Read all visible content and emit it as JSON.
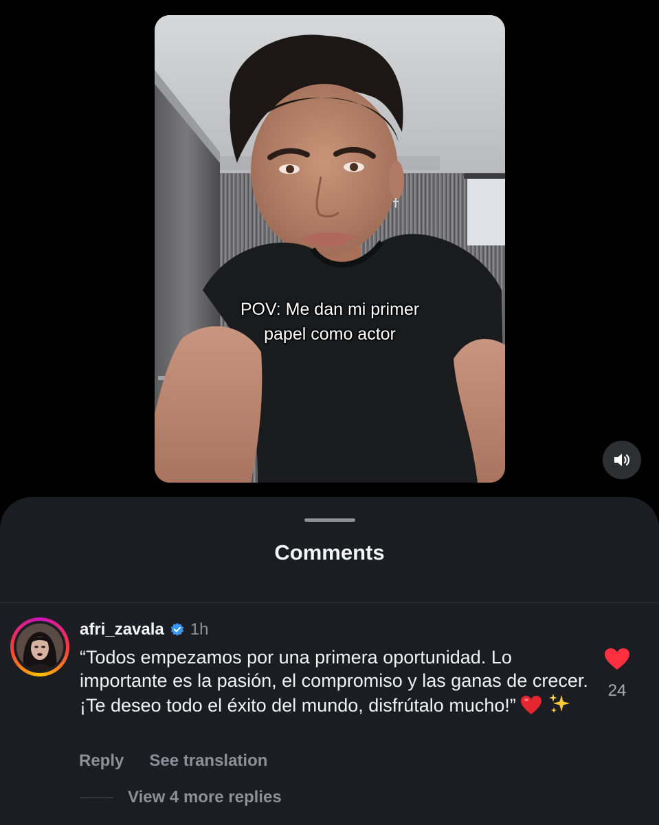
{
  "video": {
    "caption": "POV: Me dan mi primer\npapel como actor",
    "mute_icon": "speaker-muted-icon"
  },
  "comments_sheet": {
    "title": "Comments"
  },
  "comment": {
    "username": "afri_zavala",
    "verified_icon": "verified-badge-icon",
    "timestamp": "1h",
    "text": "“Todos empezamos por una primera oportunidad. Lo importante es la pasión, el compromiso y las ganas de crecer. ¡Te deseo todo el éxito del mundo, disfrútalo mucho!”",
    "emojis": [
      "red-heart",
      "sparkles"
    ],
    "like_icon": "heart-filled-icon",
    "like_count": "24",
    "reply_label": "Reply",
    "translate_label": "See translation",
    "view_replies_label": "View 4 more replies"
  },
  "colors": {
    "background": "#000000",
    "sheet": "#1c1d22",
    "like_red": "#ff3040",
    "verified_blue": "#3897f0",
    "secondary_text": "#8e9099"
  }
}
